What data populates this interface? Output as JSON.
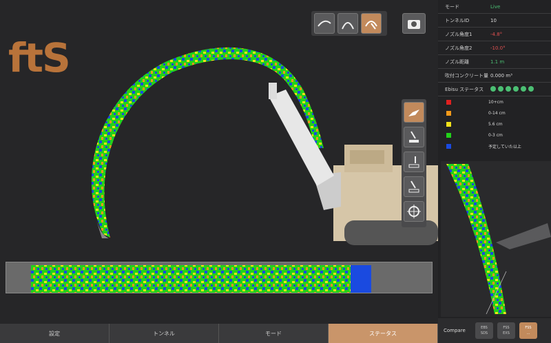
{
  "logo": "ftS",
  "toolbar": {
    "view_icons": [
      "tunnel-side-icon",
      "tunnel-section-icon",
      "tunnel-front-icon"
    ],
    "camera_icon": "camera-icon"
  },
  "side_tools": [
    "excavator-arm-icon",
    "nozzle-down-icon",
    "nozzle-add-icon",
    "nozzle-plus-icon",
    "target-icon"
  ],
  "panel": {
    "rows": [
      {
        "label": "モード",
        "value": "Live",
        "color": "#4bbf73"
      },
      {
        "label": "トンネルID",
        "value": "10",
        "color": "#dddddd"
      },
      {
        "label": "ノズル角度1",
        "value": "-4.8°",
        "color": "#e05050"
      },
      {
        "label": "ノズル角度2",
        "value": "-10.0°",
        "color": "#e05050"
      },
      {
        "label": "ノズル距離",
        "value": "1.1 m",
        "color": "#4bbf73"
      },
      {
        "label": "吹付コンクリート量",
        "value": "0.000 m³",
        "color": "#dddddd"
      }
    ],
    "status_label": "Ebisu ステータス",
    "legend": [
      {
        "color": "#e02020",
        "label": "10+cm"
      },
      {
        "color": "#f59a1a",
        "label": "0-14 cm"
      },
      {
        "color": "#f2e21a",
        "label": "5.6 cm"
      },
      {
        "color": "#22d21a",
        "label": "0-3 cm"
      },
      {
        "color": "#1a4ae0",
        "label": "予定していた以上"
      }
    ]
  },
  "compare": {
    "label": "Compare",
    "buttons": [
      {
        "top": "EBS",
        "bottom": "SDS"
      },
      {
        "top": "FSS",
        "bottom": "EXS"
      },
      {
        "top": "FSS",
        "bottom": "..."
      }
    ]
  },
  "nav": {
    "tabs": [
      "設定",
      "トンネル",
      "モード",
      "ステータス"
    ],
    "active": 3
  },
  "colors": {
    "accent": "#c9956a",
    "live": "#4bbf73"
  }
}
